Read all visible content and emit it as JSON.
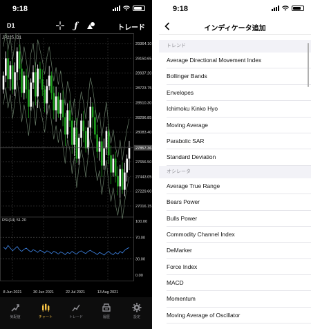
{
  "left": {
    "status": {
      "time": "9:18"
    },
    "toolbar": {
      "timeframe": "D1",
      "trade_label": "トレード",
      "icons": [
        "crosshair-icon",
        "function-icon",
        "shapes-icon"
      ]
    },
    "chart": {
      "symbol_label": "JP225, D1",
      "price_ticks": [
        "29364.10",
        "29150.65",
        "28937.20",
        "28723.75",
        "28510.30",
        "28296.85",
        "28083.40",
        "27869.95",
        "27656.50",
        "27443.05",
        "27229.60",
        "27016.15"
      ],
      "current_price": "27857.36",
      "rsi_label": "RSI(14) 51.20",
      "rsi_ticks": [
        "100.00",
        "70.00",
        "30.00",
        "0.00"
      ],
      "date_ticks": [
        "8 Jun 2021",
        "30 Jun 2021",
        "22 Jul 2021",
        "13 Aug 2021"
      ],
      "colors": {
        "bull": "#ffffff",
        "bear": "#1fa21f",
        "bands": "#6a7f6a",
        "rsi": "#3a7bd5",
        "price_tag": "#444444"
      }
    },
    "tabs": [
      {
        "label": "気配値",
        "icon": "quotes-icon"
      },
      {
        "label": "チャート",
        "icon": "chart-icon"
      },
      {
        "label": "トレード",
        "icon": "trade-icon"
      },
      {
        "label": "履歴",
        "icon": "history-icon"
      },
      {
        "label": "設定",
        "icon": "settings-icon"
      }
    ]
  },
  "right": {
    "status": {
      "time": "9:18"
    },
    "nav": {
      "title": "インディケータ追加",
      "back_icon": "chevron-left-icon"
    },
    "sections": [
      {
        "header": "トレンド",
        "items": [
          "Average Directional Movement Index",
          "Bollinger Bands",
          "Envelopes",
          "Ichimoku Kinko Hyo",
          "Moving Average",
          "Parabolic SAR",
          "Standard Deviation"
        ]
      },
      {
        "header": "オシレータ",
        "items": [
          "Average True Range",
          "Bears Power",
          "Bulls Power",
          "Commodity Channel Index",
          "DeMarker",
          "Force Index",
          "MACD",
          "Momentum",
          "Moving Average of Oscillator"
        ]
      }
    ]
  }
}
